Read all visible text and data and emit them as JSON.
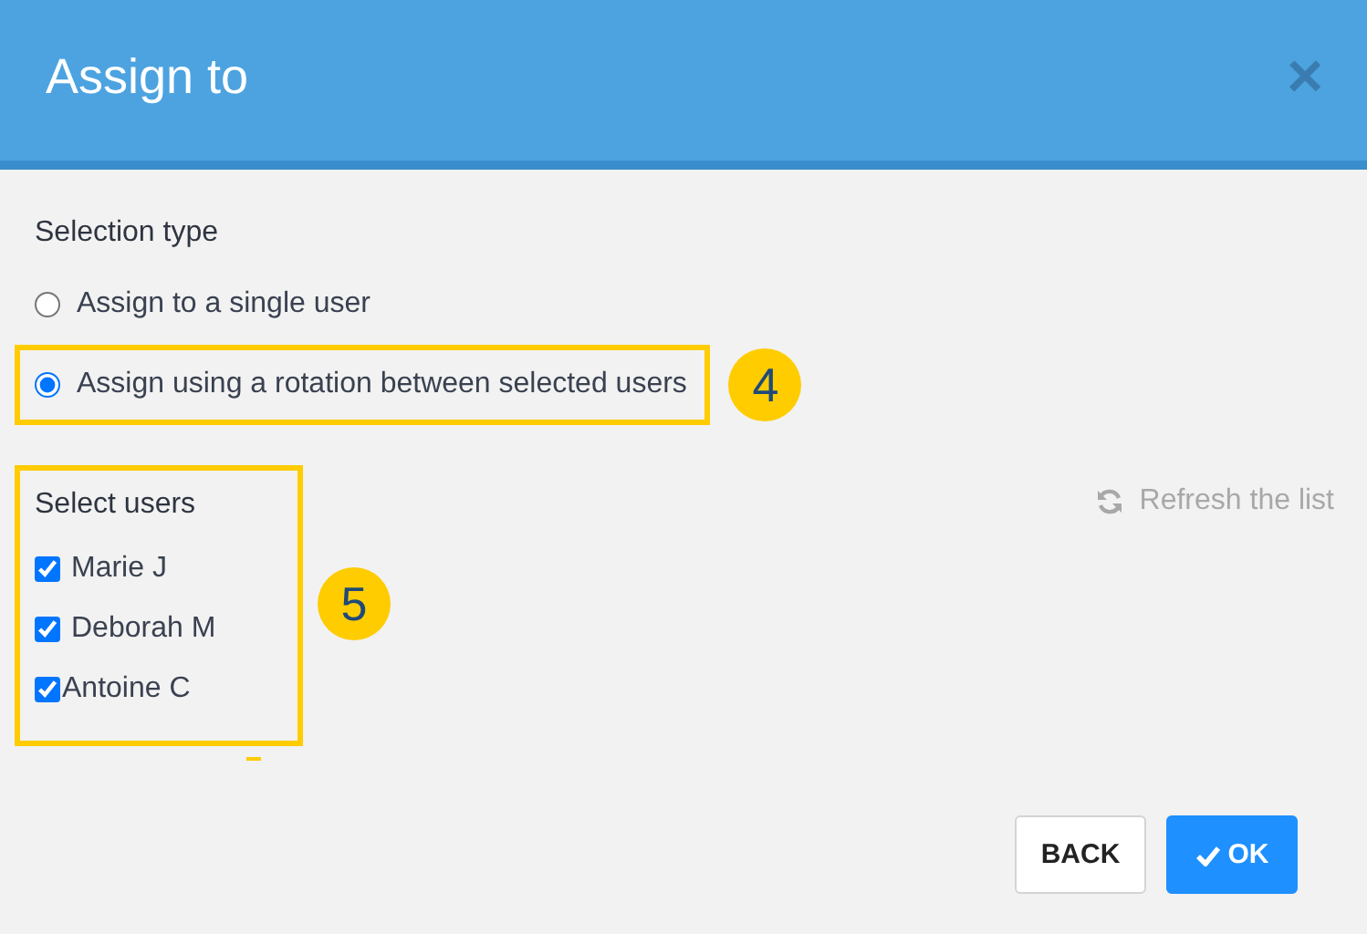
{
  "dialog": {
    "title": "Assign to",
    "close": "×"
  },
  "selection_type": {
    "label": "Selection type",
    "options": [
      {
        "label": "Assign to a single user",
        "selected": false,
        "highlighted": false
      },
      {
        "label": "Assign using a rotation between selected users",
        "selected": true,
        "highlighted": true,
        "callout": "4"
      }
    ]
  },
  "users": {
    "label": "Select users",
    "callout": "5",
    "items": [
      {
        "name": "Marie J",
        "checked": true
      },
      {
        "name": "Deborah M",
        "checked": true
      },
      {
        "name": "Antoine C",
        "checked": true
      }
    ]
  },
  "refresh": {
    "label": "Refresh the list"
  },
  "buttons": [
    {
      "kind": "secondary",
      "label": "BACK"
    },
    {
      "kind": "primary",
      "label": "OK"
    }
  ]
}
